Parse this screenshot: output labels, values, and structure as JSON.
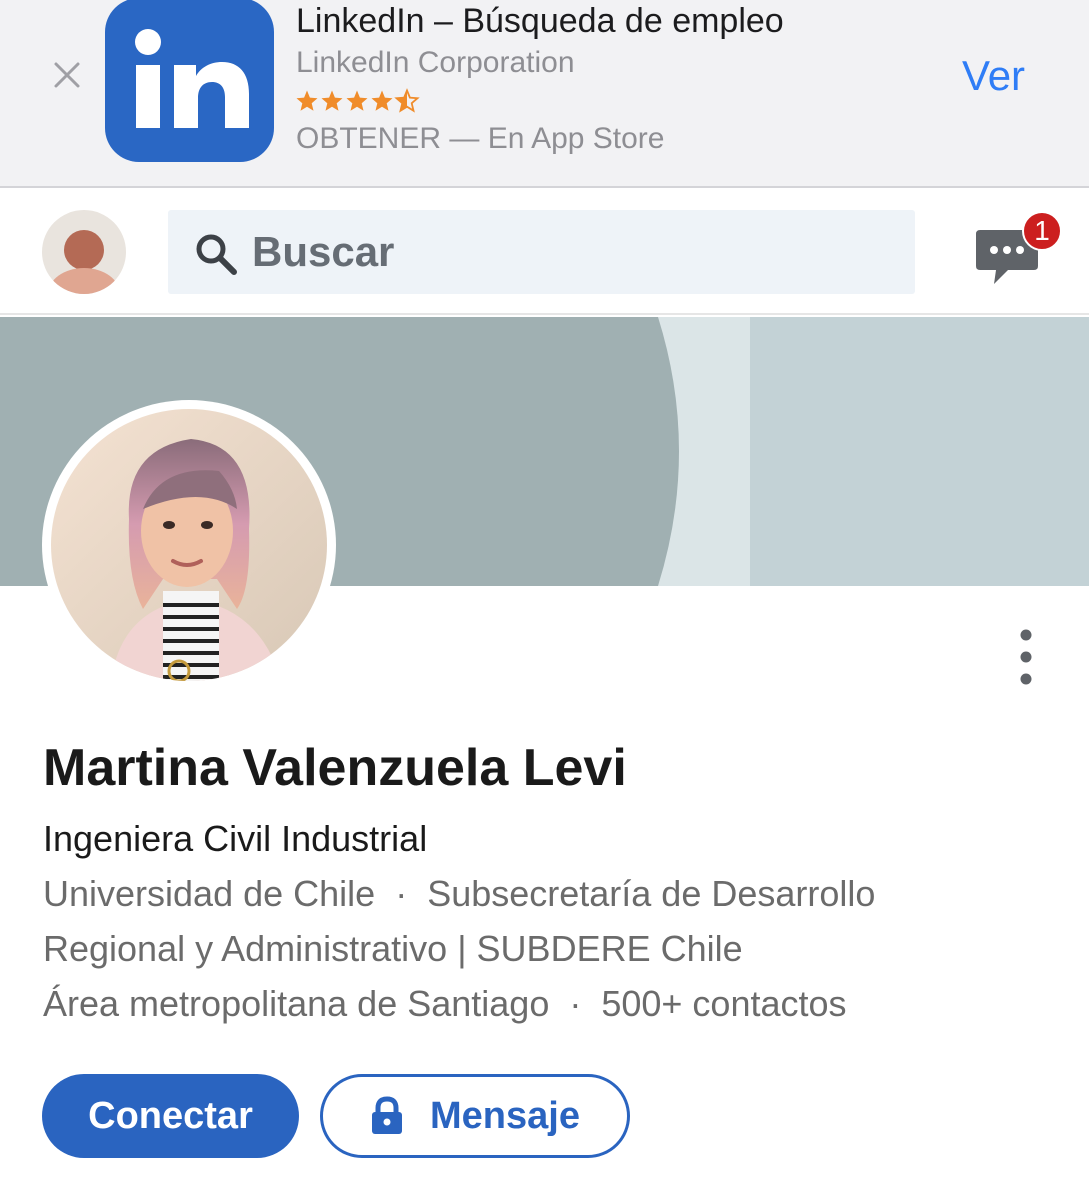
{
  "app_banner": {
    "app_name": "LinkedIn – Búsqueda de empleo",
    "developer": "LinkedIn Corporation",
    "rating_stars": 4.5,
    "subtitle": "OBTENER — En App Store",
    "view_label": "Ver",
    "icon": "linkedin-logo-icon",
    "icon_text": "in"
  },
  "nav": {
    "search_placeholder": "Buscar",
    "messages_badge": "1"
  },
  "profile": {
    "name": "Martina Valenzuela Levi",
    "headline": "Ingeniera Civil Industrial",
    "education": "Universidad de Chile",
    "employer_line1": "Subsecretaría de Desarrollo",
    "employer_line2": "Regional y Administrativo | SUBDERE Chile",
    "location": "Área metropolitana de Santiago",
    "connections": "500+ contactos",
    "separator": "·"
  },
  "actions": {
    "connect_label": "Conectar",
    "message_label": "Mensaje"
  },
  "colors": {
    "brand_blue": "#2a64c0",
    "ios_link_blue": "#2f7df6",
    "star_orange": "#f08c2a",
    "badge_red": "#cc1f1f",
    "cover_dark": "#a0b0b2",
    "cover_light": "#c3d2d6"
  }
}
